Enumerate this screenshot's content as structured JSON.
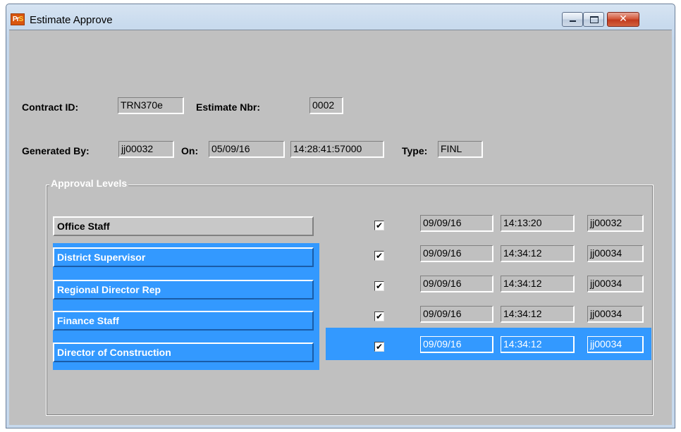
{
  "window": {
    "title": "Estimate Approve",
    "icon": "PrSM-app-icon",
    "close_glyph": "✕"
  },
  "header": {
    "contract_id_label": "Contract ID:",
    "contract_id": "TRN370e",
    "estimate_nbr_label": "Estimate Nbr:",
    "estimate_nbr": "0002",
    "generated_by_label": "Generated By:",
    "generated_by": "jj00032",
    "on_label": "On:",
    "on_date": "05/09/16",
    "on_time": "14:28:41:57000",
    "type_label": "Type:",
    "type": "FINL"
  },
  "approval": {
    "group_title": "Approval Levels",
    "levels": [
      {
        "label": "Office Staff",
        "checked": "✔",
        "date": "09/09/16",
        "time": "14:13:20",
        "user": "jj00032"
      },
      {
        "label": "District Supervisor",
        "checked": "✔",
        "date": "09/09/16",
        "time": "14:34:12",
        "user": "jj00034"
      },
      {
        "label": "Regional Director Rep",
        "checked": "✔",
        "date": "09/09/16",
        "time": "14:34:12",
        "user": "jj00034"
      },
      {
        "label": "Finance Staff",
        "checked": "✔",
        "date": "09/09/16",
        "time": "14:34:12",
        "user": "jj00034"
      },
      {
        "label": "Director of Construction",
        "checked": "✔",
        "date": "09/09/16",
        "time": "14:34:12",
        "user": "jj00034"
      }
    ]
  },
  "colors": {
    "selection": "#3399ff",
    "client_bg": "#c0c0c0",
    "close_button": "#c13a1d"
  }
}
